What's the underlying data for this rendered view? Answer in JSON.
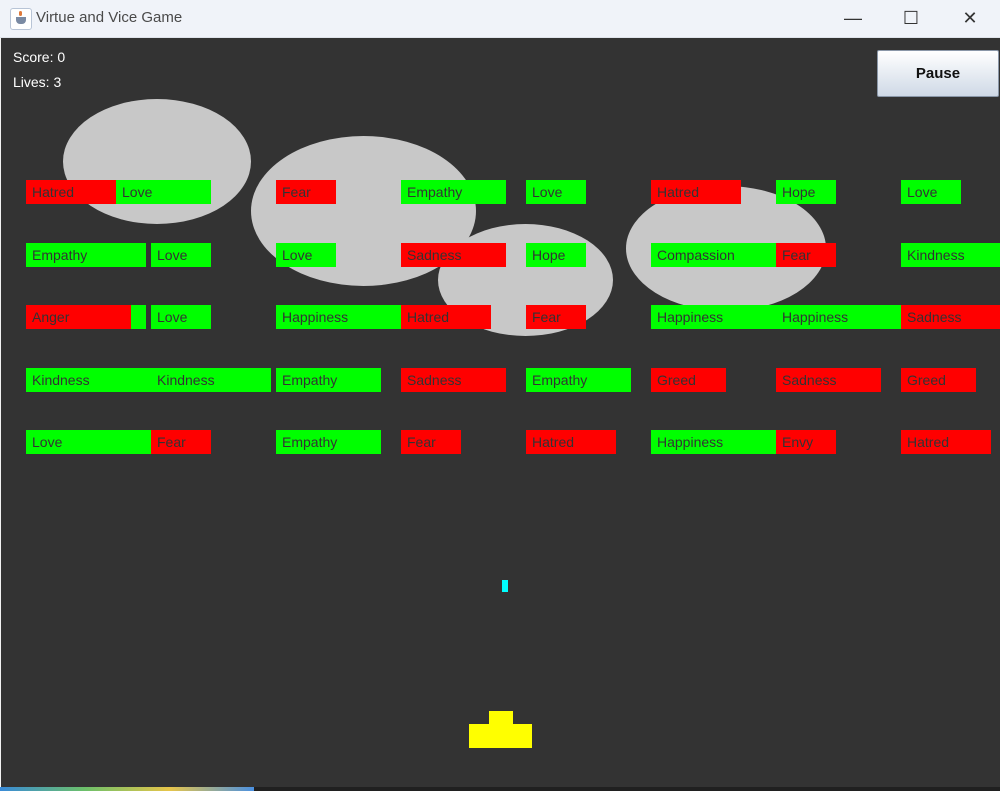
{
  "window": {
    "title": "Virtue and Vice Game",
    "controls": {
      "minimize": "—",
      "maximize": "☐",
      "close": "✕"
    }
  },
  "hud": {
    "score_text": "Score: 0",
    "lives_text": "Lives: 3",
    "pause_label": "Pause"
  },
  "colors": {
    "background": "#333333",
    "virtue": "#00ff00",
    "vice": "#ff0000",
    "cloud": "#c8c8c8",
    "ball": "#00ffff",
    "paddle": "#ffff00"
  },
  "rows": [
    [
      {
        "label": "Hatred",
        "kind": "vice"
      },
      {
        "label": "Love",
        "kind": "virtue"
      },
      {
        "label": "Fear",
        "kind": "vice"
      },
      {
        "label": "Empathy",
        "kind": "virtue"
      },
      {
        "label": "Love",
        "kind": "virtue"
      },
      {
        "label": "Hatred",
        "kind": "vice"
      },
      {
        "label": "Hope",
        "kind": "virtue"
      },
      {
        "label": "Love",
        "kind": "virtue"
      }
    ],
    [
      {
        "label": "Empathy",
        "kind": "virtue"
      },
      {
        "label": "Love",
        "kind": "virtue"
      },
      {
        "label": "Love",
        "kind": "virtue"
      },
      {
        "label": "Sadness",
        "kind": "vice"
      },
      {
        "label": "Hope",
        "kind": "virtue"
      },
      {
        "label": "Compassion",
        "kind": "virtue"
      },
      {
        "label": "Fear",
        "kind": "vice"
      },
      {
        "label": "Kindness",
        "kind": "virtue"
      }
    ],
    [
      {
        "label": "Anger",
        "kind": "vice"
      },
      {
        "label": "",
        "kind": "virtue"
      },
      {
        "label": "Love",
        "kind": "virtue"
      },
      {
        "label": "Happiness",
        "kind": "virtue"
      },
      {
        "label": "Hatred",
        "kind": "vice"
      },
      {
        "label": "Fear",
        "kind": "vice"
      },
      {
        "label": "Happiness",
        "kind": "virtue"
      },
      {
        "label": "Happiness",
        "kind": "virtue"
      },
      {
        "label": "Sadness",
        "kind": "vice"
      }
    ],
    [
      {
        "label": "Kindness",
        "kind": "virtue"
      },
      {
        "label": "Kindness",
        "kind": "virtue"
      },
      {
        "label": "Empathy",
        "kind": "virtue"
      },
      {
        "label": "Sadness",
        "kind": "vice"
      },
      {
        "label": "Empathy",
        "kind": "virtue"
      },
      {
        "label": "Greed",
        "kind": "vice"
      },
      {
        "label": "Sadness",
        "kind": "vice"
      },
      {
        "label": "Greed",
        "kind": "vice"
      }
    ],
    [
      {
        "label": "Love",
        "kind": "virtue"
      },
      {
        "label": "Fear",
        "kind": "vice"
      },
      {
        "label": "Empathy",
        "kind": "virtue"
      },
      {
        "label": "Fear",
        "kind": "vice"
      },
      {
        "label": "Hatred",
        "kind": "vice"
      },
      {
        "label": "Happiness",
        "kind": "virtue"
      },
      {
        "label": "Envy",
        "kind": "vice"
      },
      {
        "label": "Hatred",
        "kind": "vice"
      }
    ]
  ]
}
